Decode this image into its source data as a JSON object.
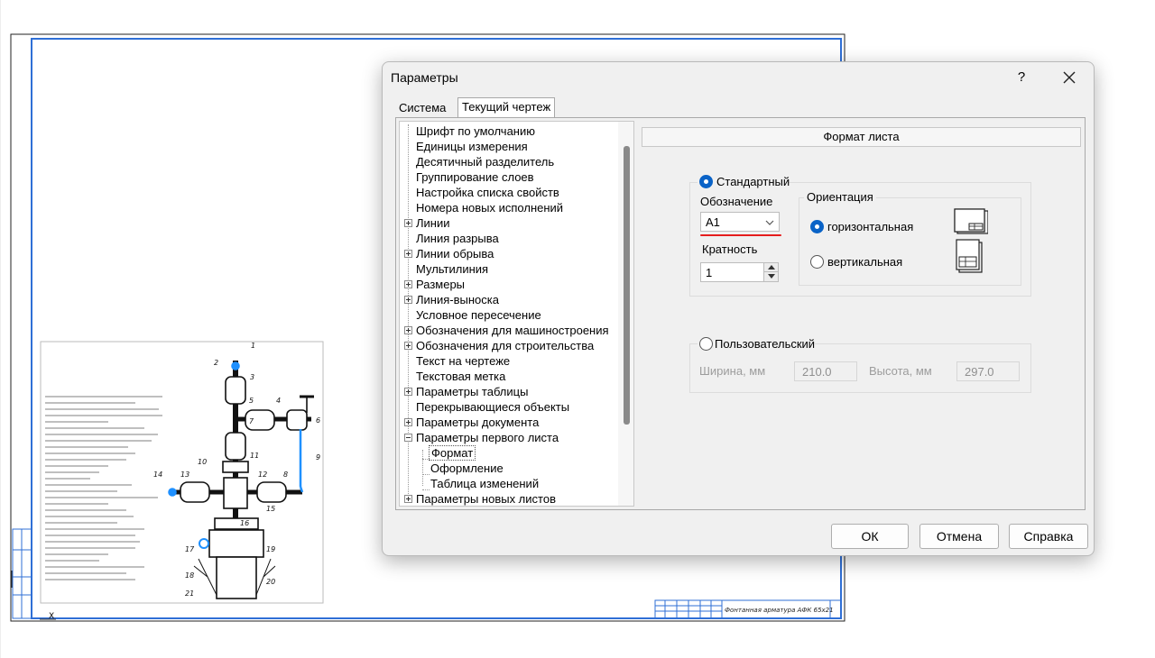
{
  "drawing": {
    "title_block_text": "Фонтанная арматура АФК 65х21",
    "callouts": [
      "1",
      "2",
      "3",
      "4",
      "5",
      "6",
      "7",
      "8",
      "9",
      "10",
      "11",
      "12",
      "13",
      "14",
      "15",
      "16",
      "17",
      "18",
      "19",
      "20",
      "21"
    ],
    "colors": {
      "frame": "#2f6fd6",
      "drawing": "#111111",
      "highlight": "#1e90ff"
    }
  },
  "dialog": {
    "title": "Параметры",
    "help_label": "?",
    "close_label": "✕",
    "tabs": [
      {
        "label": "Система"
      },
      {
        "label": "Текущий чертеж"
      }
    ],
    "tree": [
      {
        "label": "Шрифт по умолчанию"
      },
      {
        "label": "Единицы измерения"
      },
      {
        "label": "Десятичный разделитель"
      },
      {
        "label": "Группирование слоев"
      },
      {
        "label": "Настройка списка свойств"
      },
      {
        "label": "Номера новых исполнений"
      },
      {
        "label": "Линии"
      },
      {
        "label": "Линия разрыва"
      },
      {
        "label": "Линии обрыва"
      },
      {
        "label": "Мультилиния"
      },
      {
        "label": "Размеры"
      },
      {
        "label": "Линия-выноска"
      },
      {
        "label": "Условное пересечение"
      },
      {
        "label": "Обозначения для машиностроения"
      },
      {
        "label": "Обозначения для строительства"
      },
      {
        "label": "Текст на чертеже"
      },
      {
        "label": "Текстовая метка"
      },
      {
        "label": "Параметры таблицы"
      },
      {
        "label": "Перекрывающиеся объекты"
      },
      {
        "label": "Параметры документа"
      },
      {
        "label": "Параметры первого листа"
      },
      {
        "label": "Формат"
      },
      {
        "label": "Оформление"
      },
      {
        "label": "Таблица изменений"
      },
      {
        "label": "Параметры новых листов"
      }
    ],
    "panel": {
      "header": "Формат листа",
      "standard": {
        "label": "Стандартный",
        "designation_label": "Обозначение",
        "designation_value": "A1",
        "multiplicity_label": "Кратность",
        "multiplicity_value": "1"
      },
      "orientation": {
        "title": "Ориентация",
        "horizontal_label": "горизонтальная",
        "vertical_label": "вертикальная"
      },
      "custom": {
        "label": "Пользовательский",
        "width_label": "Ширина, мм",
        "width_value": "210.0",
        "height_label": "Высота, мм",
        "height_value": "297.0"
      }
    },
    "buttons": {
      "ok": "ОК",
      "cancel": "Отмена",
      "help": "Справка"
    },
    "colors": {
      "accent": "#0a63c7",
      "underline": "#e51d1d"
    }
  }
}
